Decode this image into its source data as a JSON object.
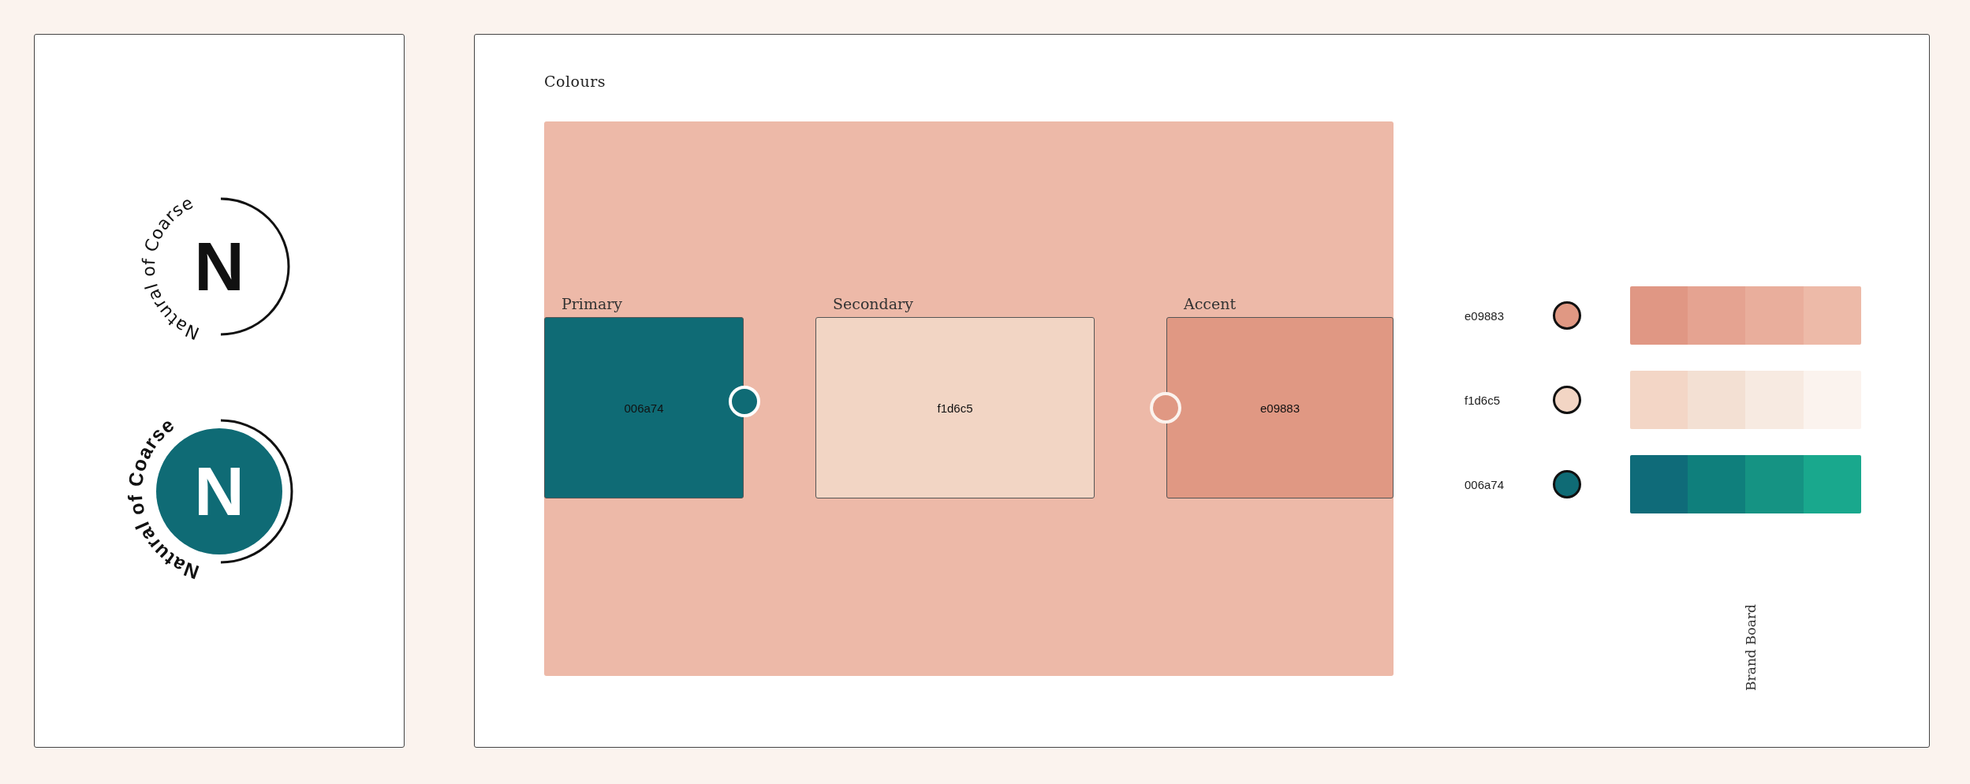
{
  "logo_panel": {
    "logos": [
      {
        "kind": "outline",
        "wordmark": "Natural of Coarse",
        "monogram": "N"
      },
      {
        "kind": "filled",
        "wordmark": "Natural of Coarse",
        "monogram": "N",
        "color": "#0f6b75"
      }
    ]
  },
  "board": {
    "title": "Colours",
    "side_label": "Brand Board",
    "swatches": [
      {
        "label": "Primary",
        "hex": "006a74",
        "color": "#0f6b75",
        "handle_right": true
      },
      {
        "label": "Secondary",
        "hex": "f1d6c5",
        "color": "#f2d5c4"
      },
      {
        "label": "Accent",
        "hex": "e09883",
        "color": "#e09883",
        "handle_left": true
      }
    ],
    "palette": [
      {
        "hex": "e09883",
        "color": "#e09883",
        "shades": [
          {
            "color": "#e09784"
          },
          {
            "color": "#e5a391"
          },
          {
            "color": "#e9ae9c"
          },
          {
            "color": "#edbaa8"
          }
        ]
      },
      {
        "hex": "f1d6c5",
        "color": "#f2d5c4",
        "shades": [
          {
            "color": "#f3d6c6"
          },
          {
            "color": "#f3e0d3"
          },
          {
            "color": "#f7eae1"
          },
          {
            "color": "#fbf3ee"
          }
        ]
      },
      {
        "hex": "006a74",
        "color": "#0f6b75",
        "shades": [
          {
            "color": "#0f6b79"
          },
          {
            "color": "#0f7f7c"
          },
          {
            "color": "#159383"
          },
          {
            "color": "#19a88d"
          }
        ]
      }
    ]
  }
}
